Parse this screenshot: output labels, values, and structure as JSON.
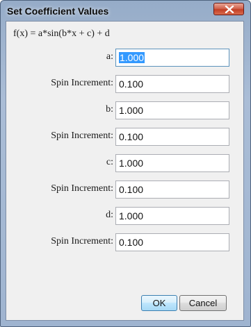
{
  "window": {
    "title": "Set Coefficient Values"
  },
  "formula": "f(x) = a*sin(b*x + c) + d",
  "fields": [
    {
      "label": "a:",
      "value": "1.000",
      "selected": true
    },
    {
      "label": "Spin Increment:",
      "value": "0.100"
    },
    {
      "label": "b:",
      "value": "1.000"
    },
    {
      "label": "Spin Increment:",
      "value": "0.100"
    },
    {
      "label": "c:",
      "value": "1.000"
    },
    {
      "label": "Spin Increment:",
      "value": "0.100"
    },
    {
      "label": "d:",
      "value": "1.000"
    },
    {
      "label": "Spin Increment:",
      "value": "0.100"
    }
  ],
  "buttons": {
    "ok": "OK",
    "cancel": "Cancel"
  },
  "icons": {
    "close": "close-icon"
  },
  "colors": {
    "selection": "#3399ff",
    "close_button": "#c23f26"
  }
}
